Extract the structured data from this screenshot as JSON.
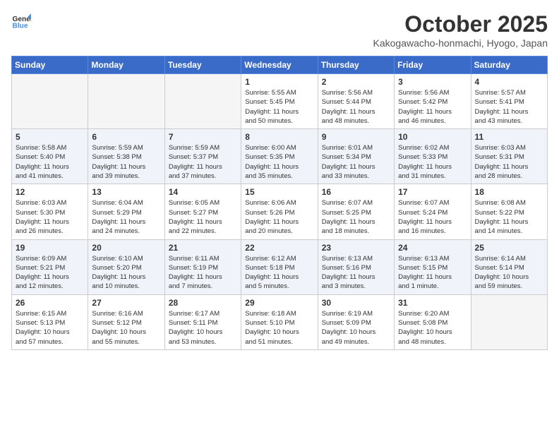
{
  "header": {
    "logo_general": "General",
    "logo_blue": "Blue",
    "month": "October 2025",
    "location": "Kakogawacho-honmachi, Hyogo, Japan"
  },
  "weekdays": [
    "Sunday",
    "Monday",
    "Tuesday",
    "Wednesday",
    "Thursday",
    "Friday",
    "Saturday"
  ],
  "weeks": [
    [
      {
        "day": "",
        "info": ""
      },
      {
        "day": "",
        "info": ""
      },
      {
        "day": "",
        "info": ""
      },
      {
        "day": "1",
        "info": "Sunrise: 5:55 AM\nSunset: 5:45 PM\nDaylight: 11 hours\nand 50 minutes."
      },
      {
        "day": "2",
        "info": "Sunrise: 5:56 AM\nSunset: 5:44 PM\nDaylight: 11 hours\nand 48 minutes."
      },
      {
        "day": "3",
        "info": "Sunrise: 5:56 AM\nSunset: 5:42 PM\nDaylight: 11 hours\nand 46 minutes."
      },
      {
        "day": "4",
        "info": "Sunrise: 5:57 AM\nSunset: 5:41 PM\nDaylight: 11 hours\nand 43 minutes."
      }
    ],
    [
      {
        "day": "5",
        "info": "Sunrise: 5:58 AM\nSunset: 5:40 PM\nDaylight: 11 hours\nand 41 minutes."
      },
      {
        "day": "6",
        "info": "Sunrise: 5:59 AM\nSunset: 5:38 PM\nDaylight: 11 hours\nand 39 minutes."
      },
      {
        "day": "7",
        "info": "Sunrise: 5:59 AM\nSunset: 5:37 PM\nDaylight: 11 hours\nand 37 minutes."
      },
      {
        "day": "8",
        "info": "Sunrise: 6:00 AM\nSunset: 5:35 PM\nDaylight: 11 hours\nand 35 minutes."
      },
      {
        "day": "9",
        "info": "Sunrise: 6:01 AM\nSunset: 5:34 PM\nDaylight: 11 hours\nand 33 minutes."
      },
      {
        "day": "10",
        "info": "Sunrise: 6:02 AM\nSunset: 5:33 PM\nDaylight: 11 hours\nand 31 minutes."
      },
      {
        "day": "11",
        "info": "Sunrise: 6:03 AM\nSunset: 5:31 PM\nDaylight: 11 hours\nand 28 minutes."
      }
    ],
    [
      {
        "day": "12",
        "info": "Sunrise: 6:03 AM\nSunset: 5:30 PM\nDaylight: 11 hours\nand 26 minutes."
      },
      {
        "day": "13",
        "info": "Sunrise: 6:04 AM\nSunset: 5:29 PM\nDaylight: 11 hours\nand 24 minutes."
      },
      {
        "day": "14",
        "info": "Sunrise: 6:05 AM\nSunset: 5:27 PM\nDaylight: 11 hours\nand 22 minutes."
      },
      {
        "day": "15",
        "info": "Sunrise: 6:06 AM\nSunset: 5:26 PM\nDaylight: 11 hours\nand 20 minutes."
      },
      {
        "day": "16",
        "info": "Sunrise: 6:07 AM\nSunset: 5:25 PM\nDaylight: 11 hours\nand 18 minutes."
      },
      {
        "day": "17",
        "info": "Sunrise: 6:07 AM\nSunset: 5:24 PM\nDaylight: 11 hours\nand 16 minutes."
      },
      {
        "day": "18",
        "info": "Sunrise: 6:08 AM\nSunset: 5:22 PM\nDaylight: 11 hours\nand 14 minutes."
      }
    ],
    [
      {
        "day": "19",
        "info": "Sunrise: 6:09 AM\nSunset: 5:21 PM\nDaylight: 11 hours\nand 12 minutes."
      },
      {
        "day": "20",
        "info": "Sunrise: 6:10 AM\nSunset: 5:20 PM\nDaylight: 11 hours\nand 10 minutes."
      },
      {
        "day": "21",
        "info": "Sunrise: 6:11 AM\nSunset: 5:19 PM\nDaylight: 11 hours\nand 7 minutes."
      },
      {
        "day": "22",
        "info": "Sunrise: 6:12 AM\nSunset: 5:18 PM\nDaylight: 11 hours\nand 5 minutes."
      },
      {
        "day": "23",
        "info": "Sunrise: 6:13 AM\nSunset: 5:16 PM\nDaylight: 11 hours\nand 3 minutes."
      },
      {
        "day": "24",
        "info": "Sunrise: 6:13 AM\nSunset: 5:15 PM\nDaylight: 11 hours\nand 1 minute."
      },
      {
        "day": "25",
        "info": "Sunrise: 6:14 AM\nSunset: 5:14 PM\nDaylight: 10 hours\nand 59 minutes."
      }
    ],
    [
      {
        "day": "26",
        "info": "Sunrise: 6:15 AM\nSunset: 5:13 PM\nDaylight: 10 hours\nand 57 minutes."
      },
      {
        "day": "27",
        "info": "Sunrise: 6:16 AM\nSunset: 5:12 PM\nDaylight: 10 hours\nand 55 minutes."
      },
      {
        "day": "28",
        "info": "Sunrise: 6:17 AM\nSunset: 5:11 PM\nDaylight: 10 hours\nand 53 minutes."
      },
      {
        "day": "29",
        "info": "Sunrise: 6:18 AM\nSunset: 5:10 PM\nDaylight: 10 hours\nand 51 minutes."
      },
      {
        "day": "30",
        "info": "Sunrise: 6:19 AM\nSunset: 5:09 PM\nDaylight: 10 hours\nand 49 minutes."
      },
      {
        "day": "31",
        "info": "Sunrise: 6:20 AM\nSunset: 5:08 PM\nDaylight: 10 hours\nand 48 minutes."
      },
      {
        "day": "",
        "info": ""
      }
    ]
  ]
}
